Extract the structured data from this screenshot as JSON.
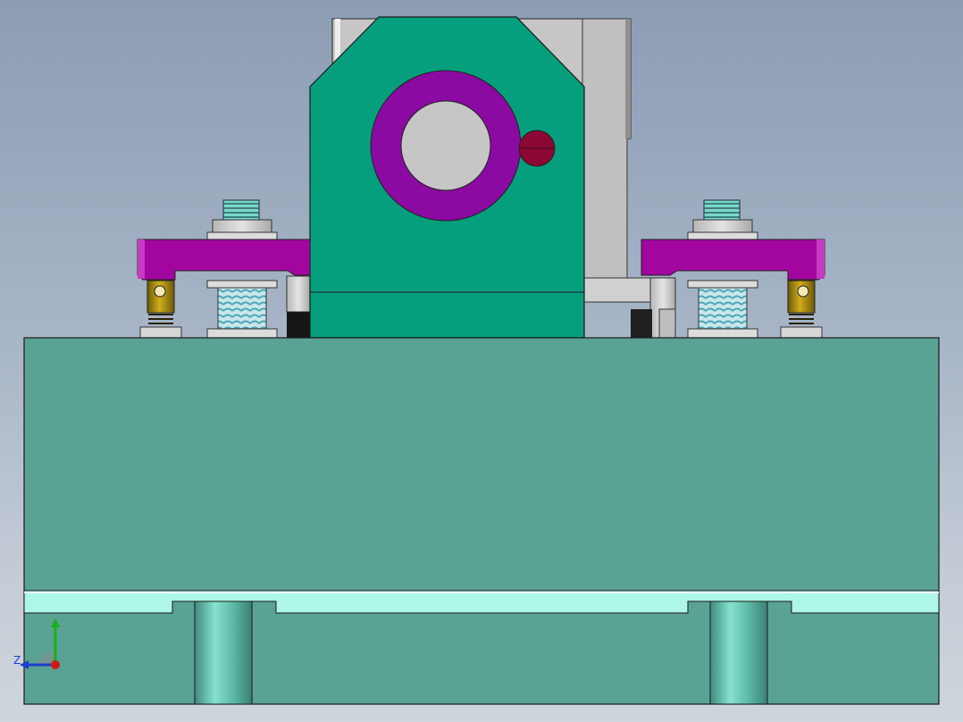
{
  "viewport": {
    "background_top": "#8c9db3",
    "background_bottom": "#cfd5dc"
  },
  "colors": {
    "base_block": "#5aa293",
    "bracket_body": "#069f7e",
    "clamp_arm": "#a3069f",
    "bushing_ring": "#8b0aa1",
    "locating_pin_head": "#8c0735",
    "support_plate": "#c4c4c4",
    "brass_post": "#b18f10",
    "cyan_slot": "#aef6e6",
    "thread": "#8fd3d9"
  },
  "triad": {
    "z_label": "Z",
    "x_axis_color": "#1a3fd0",
    "y_axis_color": "#18b018",
    "origin_color": "#d01818"
  }
}
